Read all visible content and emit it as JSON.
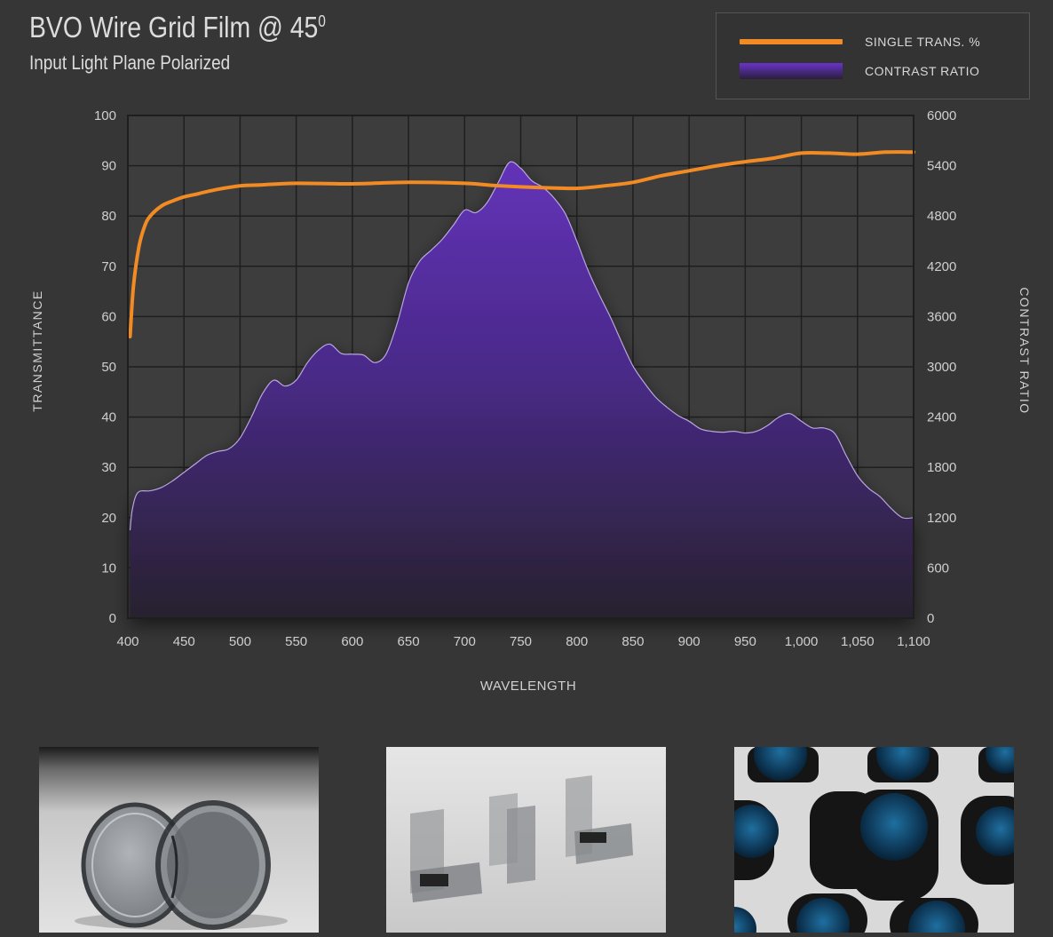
{
  "header": {
    "title": "BVO Wire Grid Film @ 45",
    "title_sup": "0",
    "subtitle": "Input Light Plane Polarized"
  },
  "legend": {
    "items": [
      {
        "label": "SINGLE TRANS. %",
        "color": "#f28b24",
        "kind": "line"
      },
      {
        "label": "CONTRAST RATIO",
        "color": "#5b2aa6",
        "kind": "area"
      }
    ]
  },
  "chart_data": {
    "type": "line",
    "title": "BVO Wire Grid Film @ 45⁰",
    "subtitle": "Input Light Plane Polarized",
    "xlabel": "WAVELENGTH",
    "ylabel": "TRANSMITTANCE",
    "y2label": "CONTRAST RATIO",
    "xlim": [
      400,
      1100
    ],
    "ylim": [
      0,
      100
    ],
    "y2lim": [
      0,
      6000
    ],
    "x_ticks": [
      "400",
      "450",
      "500",
      "550",
      "600",
      "650",
      "700",
      "750",
      "800",
      "850",
      "900",
      "950",
      "1,000",
      "1,050",
      "1,100"
    ],
    "y_ticks": [
      "0",
      "10",
      "20",
      "30",
      "40",
      "50",
      "60",
      "70",
      "80",
      "90",
      "100"
    ],
    "y2_ticks": [
      "0",
      "600",
      "1200",
      "1800",
      "2400",
      "3000",
      "3600",
      "4200",
      "4800",
      "5400",
      "6000"
    ],
    "grid": true,
    "legend_position": "top-right",
    "series": [
      {
        "name": "SINGLE TRANS. %",
        "axis": "left",
        "color": "#f28b24",
        "x": [
          402,
          405,
          410,
          415,
          420,
          430,
          440,
          450,
          460,
          480,
          500,
          520,
          550,
          600,
          650,
          700,
          725,
          750,
          775,
          800,
          825,
          850,
          875,
          900,
          925,
          950,
          975,
          1000,
          1025,
          1050,
          1075,
          1100
        ],
        "y": [
          56,
          66,
          74,
          78,
          80,
          82,
          83,
          83.8,
          84.3,
          85.3,
          86,
          86.2,
          86.5,
          86.4,
          86.7,
          86.5,
          86.1,
          85.8,
          85.6,
          85.5,
          86,
          86.7,
          88,
          89,
          90,
          90.8,
          91.5,
          92.5,
          92.5,
          92.3,
          92.7,
          92.7
        ]
      },
      {
        "name": "CONTRAST RATIO",
        "axis": "right",
        "color": "#5b2aa6",
        "x": [
          402,
          404,
          409,
          420,
          430,
          440,
          450,
          460,
          470,
          480,
          490,
          500,
          510,
          520,
          530,
          540,
          550,
          560,
          570,
          580,
          590,
          600,
          610,
          620,
          630,
          640,
          650,
          660,
          670,
          680,
          690,
          700,
          710,
          720,
          730,
          740,
          750,
          760,
          770,
          780,
          790,
          800,
          810,
          820,
          830,
          840,
          850,
          860,
          870,
          880,
          890,
          900,
          910,
          920,
          930,
          940,
          950,
          960,
          970,
          980,
          990,
          1000,
          1010,
          1020,
          1030,
          1040,
          1050,
          1060,
          1070,
          1080,
          1090,
          1100
        ],
        "y": [
          1050,
          1300,
          1500,
          1520,
          1560,
          1640,
          1740,
          1840,
          1940,
          1990,
          2020,
          2150,
          2400,
          2680,
          2840,
          2770,
          2840,
          3050,
          3200,
          3270,
          3160,
          3150,
          3140,
          3050,
          3150,
          3520,
          4000,
          4260,
          4390,
          4520,
          4690,
          4870,
          4840,
          4960,
          5200,
          5440,
          5370,
          5220,
          5140,
          5010,
          4820,
          4500,
          4150,
          3860,
          3590,
          3290,
          3010,
          2810,
          2640,
          2520,
          2420,
          2350,
          2260,
          2230,
          2220,
          2230,
          2210,
          2230,
          2300,
          2400,
          2440,
          2350,
          2270,
          2270,
          2200,
          1940,
          1700,
          1550,
          1450,
          1310,
          1200,
          1200
        ]
      }
    ]
  },
  "photos": [
    {
      "name": "polarizer-discs-photo"
    },
    {
      "name": "slide-polarizers-photo"
    },
    {
      "name": "mounted-polarizers-photo"
    }
  ]
}
